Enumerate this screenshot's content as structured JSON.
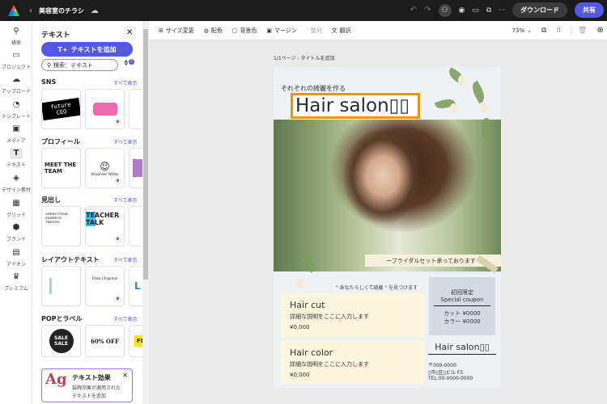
{
  "topbar": {
    "doc_title": "美容室のチラシ",
    "download": "ダウンロード",
    "share": "共有"
  },
  "rail": [
    {
      "icon": "search",
      "label": "検索"
    },
    {
      "icon": "folder",
      "label": "プロジェクト"
    },
    {
      "icon": "upload",
      "label": "アップロード"
    },
    {
      "icon": "template",
      "label": "テンプレート"
    },
    {
      "icon": "media",
      "label": "メディア"
    },
    {
      "icon": "text",
      "label": "テキスト"
    },
    {
      "icon": "design",
      "label": "デザイン素材"
    },
    {
      "icon": "grid",
      "label": "グリッド"
    },
    {
      "icon": "brand",
      "label": "ブランド"
    },
    {
      "icon": "addon",
      "label": "アドオン"
    },
    {
      "icon": "premium",
      "label": "プレミアム"
    }
  ],
  "panel": {
    "title": "テキスト",
    "add_text": "テキストを追加",
    "search_placeholder": "検索：テキスト",
    "filter_count": "2",
    "show_all": "すべて表示",
    "sections": [
      {
        "label": "SNS",
        "cards": [
          "future CEO",
          "",
          "",
          ""
        ]
      },
      {
        "label": "プロフィール",
        "cards": [
          "MEET THE TEAM",
          "Alexander Wilder",
          "",
          ""
        ]
      },
      {
        "label": "見出し",
        "cards": [
          "SPRINGTIME FASHION TRENDS",
          "TEACHER TALK",
          "",
          ""
        ]
      },
      {
        "label": "レイアウトテキスト",
        "cards": [
          "",
          "Frank Chapman",
          "L",
          ""
        ]
      },
      {
        "label": "POPとラベル",
        "cards": [
          "SALE SALE",
          "60% OFF",
          "FLA",
          ""
        ]
      }
    ],
    "promo": {
      "title": "テキスト効果",
      "desc1": "装飾効果が適用された",
      "desc2": "テキストを追加",
      "logo": "Ag"
    }
  },
  "toolbar": {
    "resize": "サイズ変更",
    "color": "配色",
    "bg": "背景色",
    "margin": "マージン",
    "align": "整列",
    "translate": "翻訳",
    "zoom": "73%"
  },
  "canvas": {
    "page_label": "1/1ページ - タイトルを追加"
  },
  "flyer": {
    "tagline": "それぞれの綺麗を作る",
    "title": "Hair salon▯▯",
    "banner": "ーブライダルセット承っておりますー",
    "catch": "\" あなたらしくて綺麗 \" を見つけます",
    "menu": [
      {
        "name": "Hair cut",
        "desc": "詳細な説明をここに入力します",
        "price": "¥0,000"
      },
      {
        "name": "Hair color",
        "desc": "詳細な説明をここに入力します",
        "price": "¥0,000"
      }
    ],
    "coupon": {
      "title": "初回限定",
      "subtitle": "Special coupon",
      "line1": "カット ¥0000",
      "line2": "カラー ¥0000"
    },
    "shop": {
      "name": "Hair salon▯▯",
      "zip": "〒000-0000",
      "addr": "▯市▯区▯ビル F3",
      "tel": "TEL.00-0000-0000"
    }
  }
}
